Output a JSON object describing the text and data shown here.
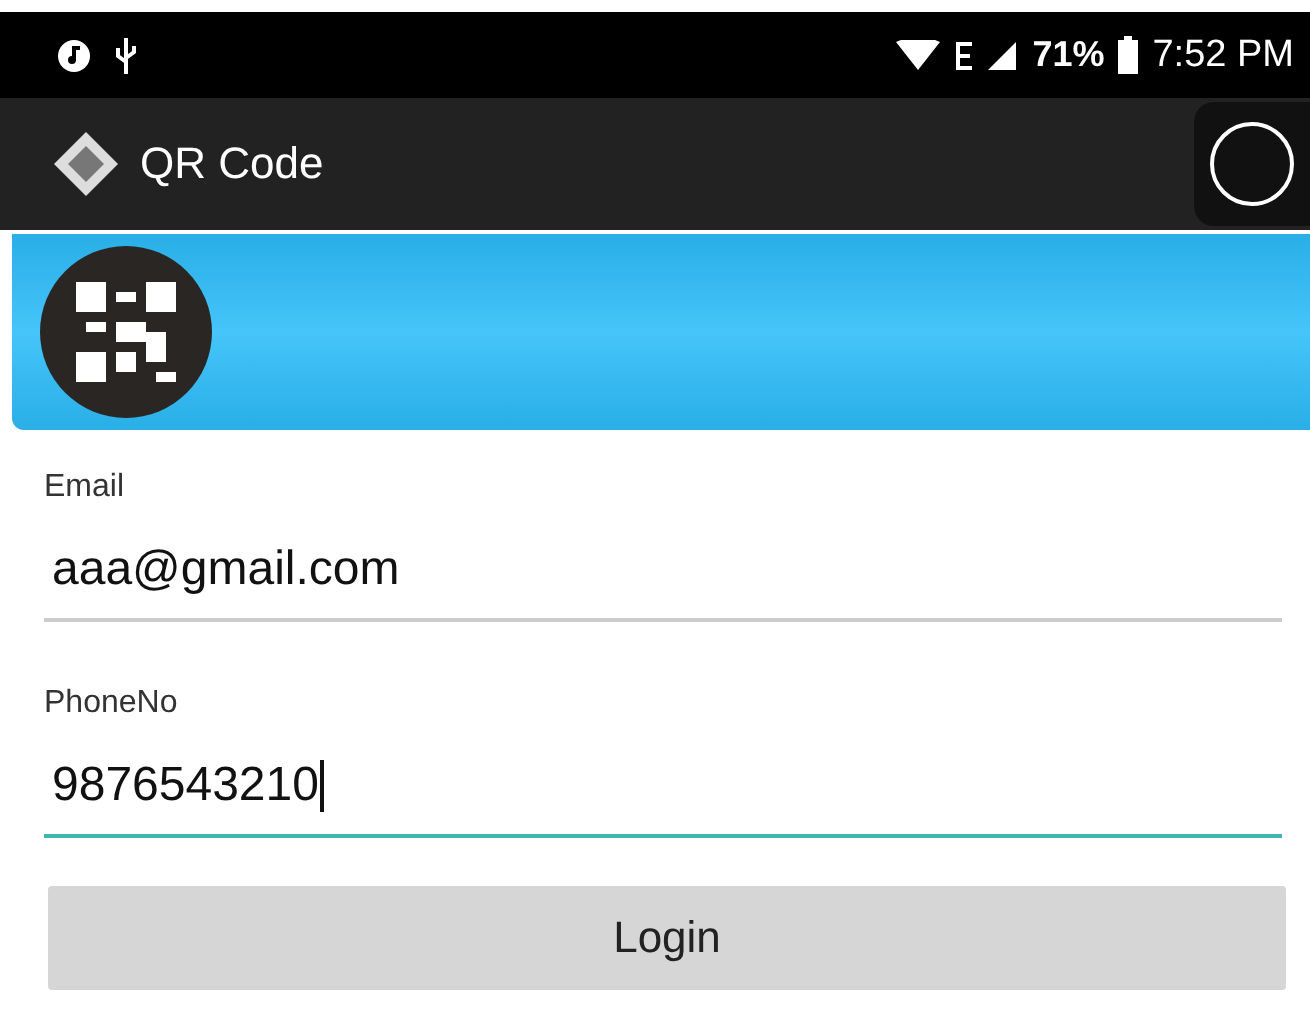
{
  "status_bar": {
    "battery": "71%",
    "time": "7:52 PM"
  },
  "app_bar": {
    "title": "QR Code"
  },
  "fields": [
    {
      "label": "Email",
      "value": "aaa@gmail.com",
      "focused": false
    },
    {
      "label": "PhoneNo",
      "value": "9876543210",
      "focused": true
    }
  ],
  "button": {
    "label": "Login"
  }
}
